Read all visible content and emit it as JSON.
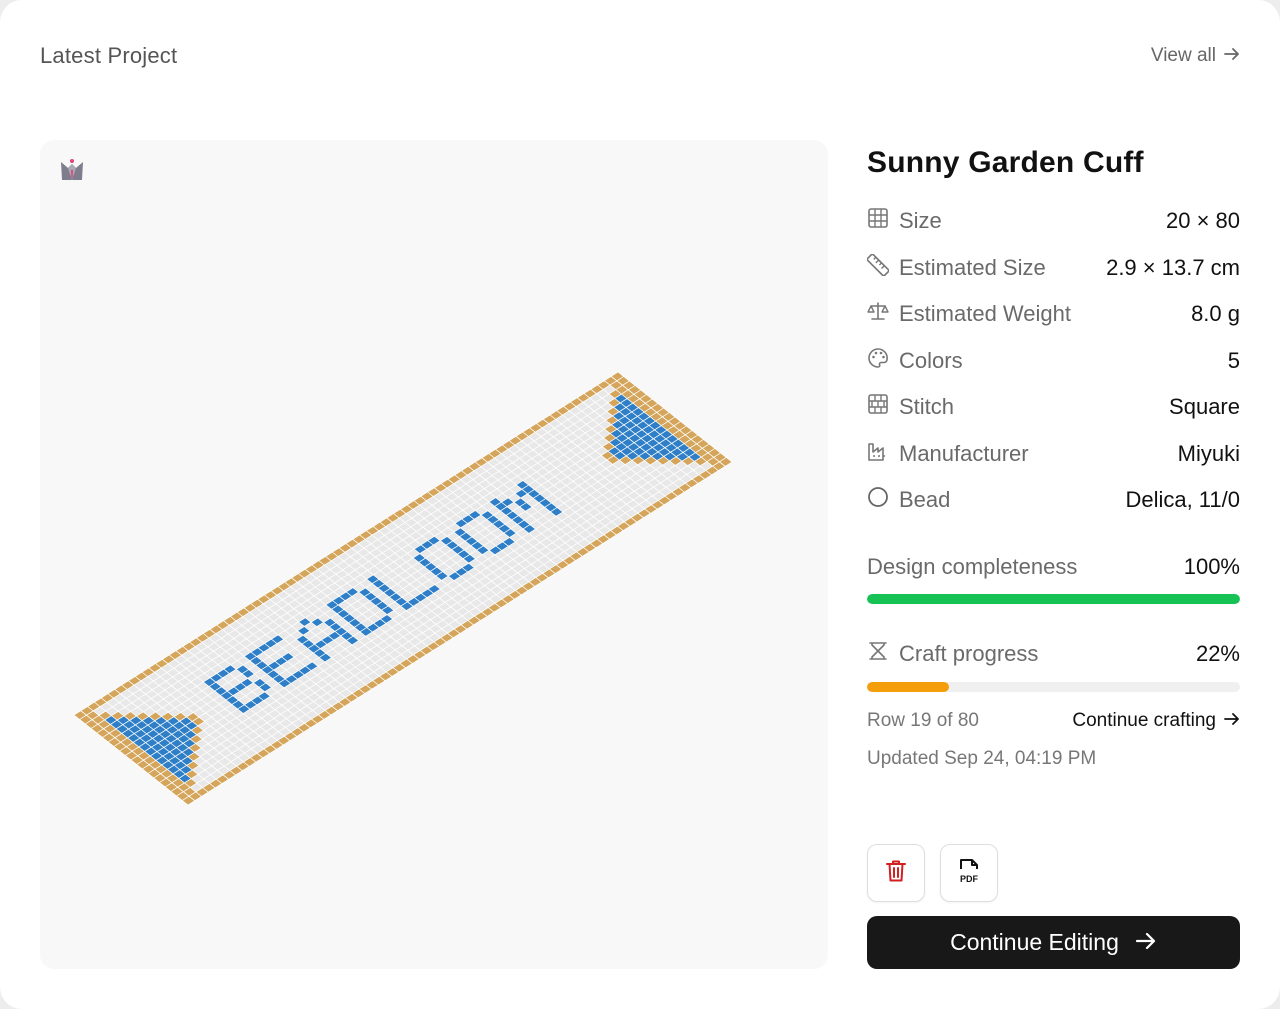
{
  "header": {
    "title": "Latest Project",
    "view_all": "View all"
  },
  "project": {
    "title": "Sunny Garden Cuff",
    "specs": [
      {
        "icon": "grid-icon",
        "label": "Size",
        "value": "20 × 80"
      },
      {
        "icon": "ruler-icon",
        "label": "Estimated Size",
        "value": "2.9 × 13.7 cm"
      },
      {
        "icon": "scale-icon",
        "label": "Estimated Weight",
        "value": "8.0 g"
      },
      {
        "icon": "palette-icon",
        "label": "Colors",
        "value": "5"
      },
      {
        "icon": "stitch-grid-icon",
        "label": "Stitch",
        "value": "Square"
      },
      {
        "icon": "factory-icon",
        "label": "Manufacturer",
        "value": "Miyuki"
      },
      {
        "icon": "circle-icon",
        "label": "Bead",
        "value": "Delica, 11/0"
      }
    ]
  },
  "design_completeness": {
    "label": "Design completeness",
    "value_text": "100%",
    "value": 1.0,
    "color": "#16c254"
  },
  "craft_progress": {
    "label": "Craft progress",
    "value_text": "22%",
    "value": 0.22,
    "color": "#f59e0b"
  },
  "row_status": "Row 19 of 80",
  "continue_crafting": "Continue crafting",
  "updated": "Updated Sep 24, 04:19 PM",
  "actions": {
    "delete_icon": "trash-icon",
    "pdf_icon": "pdf-file-icon",
    "pdf_text": "PDF",
    "primary_label": "Continue Editing"
  },
  "pattern": {
    "text": "BEADLOOM",
    "colors": {
      "background": "#e8e8e8",
      "border": "#d4a55a",
      "accent": "#2f7fc8"
    }
  }
}
